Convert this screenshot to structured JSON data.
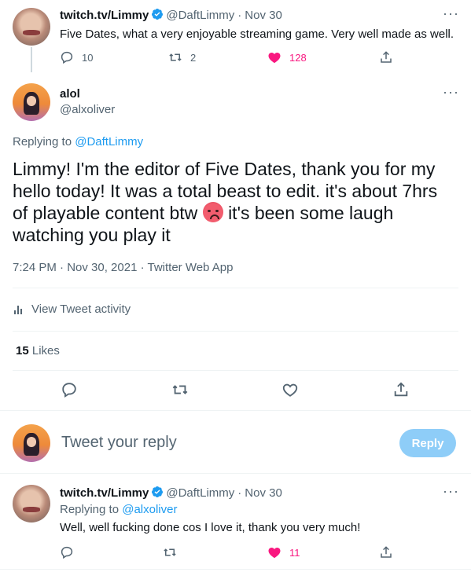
{
  "tweet1": {
    "display_name": "twitch.tv/Limmy",
    "handle": "@DaftLimmy",
    "separator": "·",
    "date": "Nov 30",
    "text": "Five Dates, what a very enjoyable streaming game. Very well made as well.",
    "replies": "10",
    "retweets": "2",
    "likes": "128"
  },
  "main_tweet": {
    "display_name": "alol",
    "handle": "@alxoliver",
    "replying_to_label": "Replying to",
    "replying_to_handle": "@DaftLimmy",
    "text_part1": "Limmy! I'm the editor of Five Dates, thank you for my hello today! It was a total beast to edit. it's about 7hrs of playable content btw",
    "text_part2": "it's been some laugh watching you play it",
    "emoji": "hot-face-emoji",
    "timestamp": "7:24 PM · Nov 30, 2021 · Twitter Web App",
    "activity_label": "View Tweet activity",
    "likes_count": "15",
    "likes_label": "Likes"
  },
  "compose": {
    "placeholder": "Tweet your reply",
    "button_label": "Reply"
  },
  "reply_tweet": {
    "display_name": "twitch.tv/Limmy",
    "handle": "@DaftLimmy",
    "separator": "·",
    "date": "Nov 30",
    "replying_to_label": "Replying to",
    "replying_to_handle": "@alxoliver",
    "text": "Well, well fucking done cos I love it, thank you very much!",
    "likes": "11"
  },
  "colors": {
    "accent": "#1d9bf0",
    "like": "#f91880",
    "muted": "#536471"
  }
}
